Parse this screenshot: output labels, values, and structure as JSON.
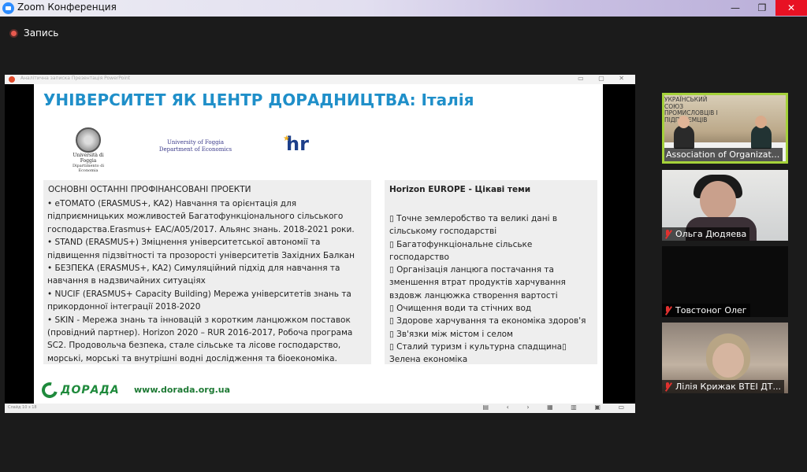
{
  "window": {
    "title": "Zoom Конференция",
    "controls": [
      "minimize",
      "restore",
      "close"
    ]
  },
  "recording": {
    "label": "Запись"
  },
  "share": {
    "presentation_title": "Аналітична записка   Презентація PowerPoint",
    "status_text": "Слайд 10 з 18",
    "slide": {
      "title": "УНІВЕРСИТЕТ ЯК ЦЕНТР ДОРАДНИЦТВА: Італія",
      "logos": {
        "foggia": [
          "Università di Foggia",
          "Dipartimento di Economia"
        ],
        "uni": [
          "University of Foggia",
          "Department of Economics"
        ],
        "hr": "hr"
      },
      "left_box": {
        "heading": "ОСНОВНІ ОСТАННІ ПРОФІНАНСОВАНІ ПРОЕКТИ",
        "lines": [
          "• eTOMATO (ERASMUS+, KA2) Навчання та орієнтація для",
          "підприємницьких можливостей Багатофункціонального сільського",
          "господарства.Erasmus+ EAC/A05/2017. Альянс знань. 2018-2021 роки.",
          "• STAND (ERASMUS+) Зміцнення університетської автономії та",
          "підвищення підзвітності та прозорості університетів Західних Балкан",
          "• БЕЗПЕКА (ERASMUS+, KA2) Симуляційний підхід для навчання та",
          "навчання в надзвичайних ситуаціях",
          "• NUCIF (ERASMUS+ Capacity Building) Мережа університетів знань та",
          "прикордонної інтеграції 2018-2020",
          "• SKIN - Мережа знань та інновацій з коротким ланцюжком поставок",
          "(провідний партнер). Horizon 2020 – RUR 2016-2017, Робоча програма",
          "SC2. Продовольча безпека, стале сільське та лісове господарство,",
          "морські, морські та внутрішні водні дослідження та біоекономіка."
        ]
      },
      "right_box": {
        "heading": "Horizon EUROPE - Цікаві теми",
        "lines": [
          "▯ Точне землеробство та великі дані в",
          "сільському господарстві",
          "▯ Багатофункціональне сільське",
          "господарство",
          "▯ Організація ланцюга постачання та",
          "зменшення втрат продуктів харчування",
          "вздовж ланцюжка створення вартості",
          "▯ Очищення води та стічних вод",
          "▯ Здорове харчування та економіка здоров'я",
          "▯ Зв'язки між містом і селом",
          "▯ Сталий туризм і культурна спадщина▯",
          "Зелена економіка"
        ]
      },
      "footer": {
        "brand": "ДОРАДА",
        "url": "www.dorada.org.ua"
      }
    }
  },
  "participants": [
    {
      "name": "Association of Organizat...",
      "muted": false,
      "active": true,
      "background_text": [
        "УКРАЇНСЬКИЙ",
        "СОЮЗ",
        "ПРОМИСЛОВЦІВ І",
        "ПІДПРИЄМЦІВ"
      ]
    },
    {
      "name": "Ольга Дюдяева",
      "muted": true
    },
    {
      "name": "Товстоног Олег",
      "muted": true
    },
    {
      "name": "Лілія Крижак ВТЕІ ДТ...",
      "muted": true
    }
  ],
  "colors": {
    "accent_green": "#a5d23a",
    "title_blue": "#1f8fc9",
    "brand_green": "#1f8a3c",
    "mute_red": "#e0312f"
  }
}
